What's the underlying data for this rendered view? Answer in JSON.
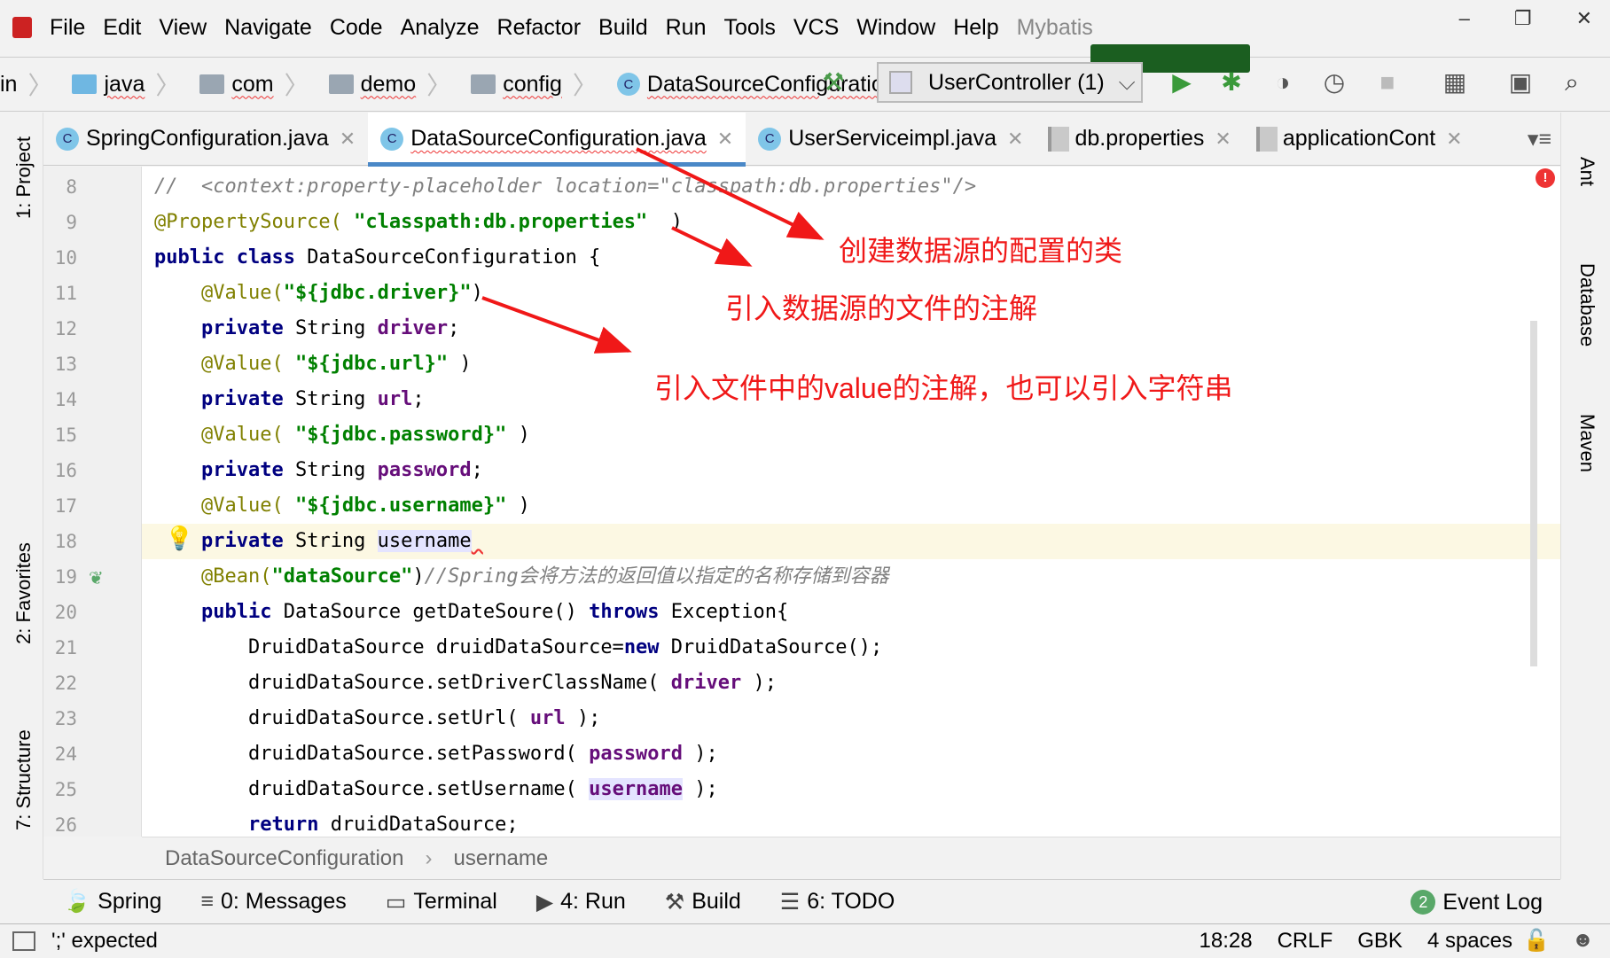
{
  "menu": [
    "File",
    "Edit",
    "View",
    "Navigate",
    "Code",
    "Analyze",
    "Refactor",
    "Build",
    "Run",
    "Tools",
    "VCS",
    "Window",
    "Help",
    "Mybatis"
  ],
  "breadcrumbs": [
    "in",
    "java",
    "com",
    "demo",
    "config",
    "DataSourceConfiguration"
  ],
  "run_config": "UserController (1)",
  "tabs": [
    {
      "label": "SpringConfiguration.java",
      "icon": "class-icon"
    },
    {
      "label": "DataSourceConfiguration.java",
      "icon": "class-icon",
      "active": true
    },
    {
      "label": "UserServiceimpl.java",
      "icon": "class-icon"
    },
    {
      "label": "db.properties",
      "icon": "properties-file-icon"
    },
    {
      "label": "applicationCont",
      "icon": "spring-xml-icon"
    }
  ],
  "left_tools": [
    "1: Project",
    "2: Favorites",
    "7: Structure"
  ],
  "right_tools": [
    "Ant",
    "Database",
    "Maven"
  ],
  "code": [
    {
      "n": "8",
      "t": [
        [
          "cmt",
          "//  <context:property-placeholder location=\"classpath:db.properties\"/>"
        ]
      ]
    },
    {
      "n": "9",
      "t": [
        [
          "ann",
          "@PropertySource( "
        ],
        [
          "str",
          "\"classpath:db.properties\""
        ],
        [
          "",
          "  )"
        ]
      ]
    },
    {
      "n": "10",
      "t": [
        [
          "kw",
          "public class "
        ],
        [
          "",
          "DataSourceConfiguration {"
        ]
      ]
    },
    {
      "n": "11",
      "t": [
        [
          "",
          "    "
        ],
        [
          "ann",
          "@Value("
        ],
        [
          "str",
          "\"${jdbc.driver}\""
        ],
        [
          "",
          ")"
        ]
      ]
    },
    {
      "n": "12",
      "t": [
        [
          "",
          "    "
        ],
        [
          "kw",
          "private "
        ],
        [
          "",
          "String "
        ],
        [
          "fld",
          "driver"
        ],
        [
          "",
          ";"
        ]
      ]
    },
    {
      "n": "13",
      "t": [
        [
          "",
          "    "
        ],
        [
          "ann",
          "@Value( "
        ],
        [
          "str",
          "\"${jdbc.url}\""
        ],
        [
          "",
          " )"
        ]
      ]
    },
    {
      "n": "14",
      "t": [
        [
          "",
          "    "
        ],
        [
          "kw",
          "private "
        ],
        [
          "",
          "String "
        ],
        [
          "fld",
          "url"
        ],
        [
          "",
          ";"
        ]
      ]
    },
    {
      "n": "15",
      "t": [
        [
          "",
          "    "
        ],
        [
          "ann",
          "@Value( "
        ],
        [
          "str",
          "\"${jdbc.password}\""
        ],
        [
          "",
          " )"
        ]
      ]
    },
    {
      "n": "16",
      "t": [
        [
          "",
          "    "
        ],
        [
          "kw",
          "private "
        ],
        [
          "",
          "String "
        ],
        [
          "fld",
          "password"
        ],
        [
          "",
          ";"
        ]
      ]
    },
    {
      "n": "17",
      "t": [
        [
          "",
          "    "
        ],
        [
          "ann",
          "@Value( "
        ],
        [
          "str",
          "\"${jdbc.username}\""
        ],
        [
          "",
          " )"
        ]
      ]
    },
    {
      "n": "18",
      "cur": true,
      "t": [
        [
          "",
          "    "
        ],
        [
          "kw",
          "private "
        ],
        [
          "",
          "String "
        ],
        [
          "hl",
          "username"
        ],
        [
          "err",
          " "
        ]
      ]
    },
    {
      "n": "19",
      "t": [
        [
          "",
          "    "
        ],
        [
          "ann",
          "@Bean("
        ],
        [
          "str",
          "\"dataSource\""
        ],
        [
          "",
          ")"
        ],
        [
          "cmt",
          "//Spring会将方法的返回值以指定的名称存储到容器"
        ]
      ]
    },
    {
      "n": "20",
      "t": [
        [
          "",
          "    "
        ],
        [
          "kw",
          "public "
        ],
        [
          "",
          "DataSource getDateSoure() "
        ],
        [
          "kw",
          "throws "
        ],
        [
          "",
          "Exception{"
        ]
      ]
    },
    {
      "n": "21",
      "t": [
        [
          "",
          "        DruidDataSource druidDataSource="
        ],
        [
          "kw",
          "new "
        ],
        [
          "",
          "DruidDataSource();"
        ]
      ]
    },
    {
      "n": "22",
      "t": [
        [
          "",
          "        druidDataSource.setDriverClassName( "
        ],
        [
          "fld",
          "driver"
        ],
        [
          "",
          " );"
        ]
      ]
    },
    {
      "n": "23",
      "t": [
        [
          "",
          "        druidDataSource.setUrl( "
        ],
        [
          "fld",
          "url"
        ],
        [
          "",
          " );"
        ]
      ]
    },
    {
      "n": "24",
      "t": [
        [
          "",
          "        druidDataSource.setPassword( "
        ],
        [
          "fld",
          "password"
        ],
        [
          "",
          " );"
        ]
      ]
    },
    {
      "n": "25",
      "t": [
        [
          "",
          "        druidDataSource.setUsername( "
        ],
        [
          "fld hl",
          "username"
        ],
        [
          "",
          " );"
        ]
      ]
    },
    {
      "n": "26",
      "t": [
        [
          "",
          "        "
        ],
        [
          "kw",
          "return "
        ],
        [
          "",
          "druidDataSource;"
        ]
      ]
    }
  ],
  "annotations": [
    "创建数据源的配置的类",
    "引入数据源的文件的注解",
    "引入文件中的value的注解，也可以引入字符串"
  ],
  "editor_breadcrumb": [
    "DataSourceConfiguration",
    "username"
  ],
  "tool_windows": [
    "Spring",
    "0: Messages",
    "Terminal",
    "4: Run",
    "Build",
    "6: TODO"
  ],
  "event_log": {
    "count": "2",
    "label": "Event Log"
  },
  "status": {
    "message": "';' expected",
    "position": "18:28",
    "line_sep": "CRLF",
    "encoding": "GBK",
    "indent": "4 spaces"
  },
  "colors": {
    "annotation_red": "#f01818",
    "keyword": "#000080",
    "string": "#008000",
    "field": "#660e7a"
  }
}
